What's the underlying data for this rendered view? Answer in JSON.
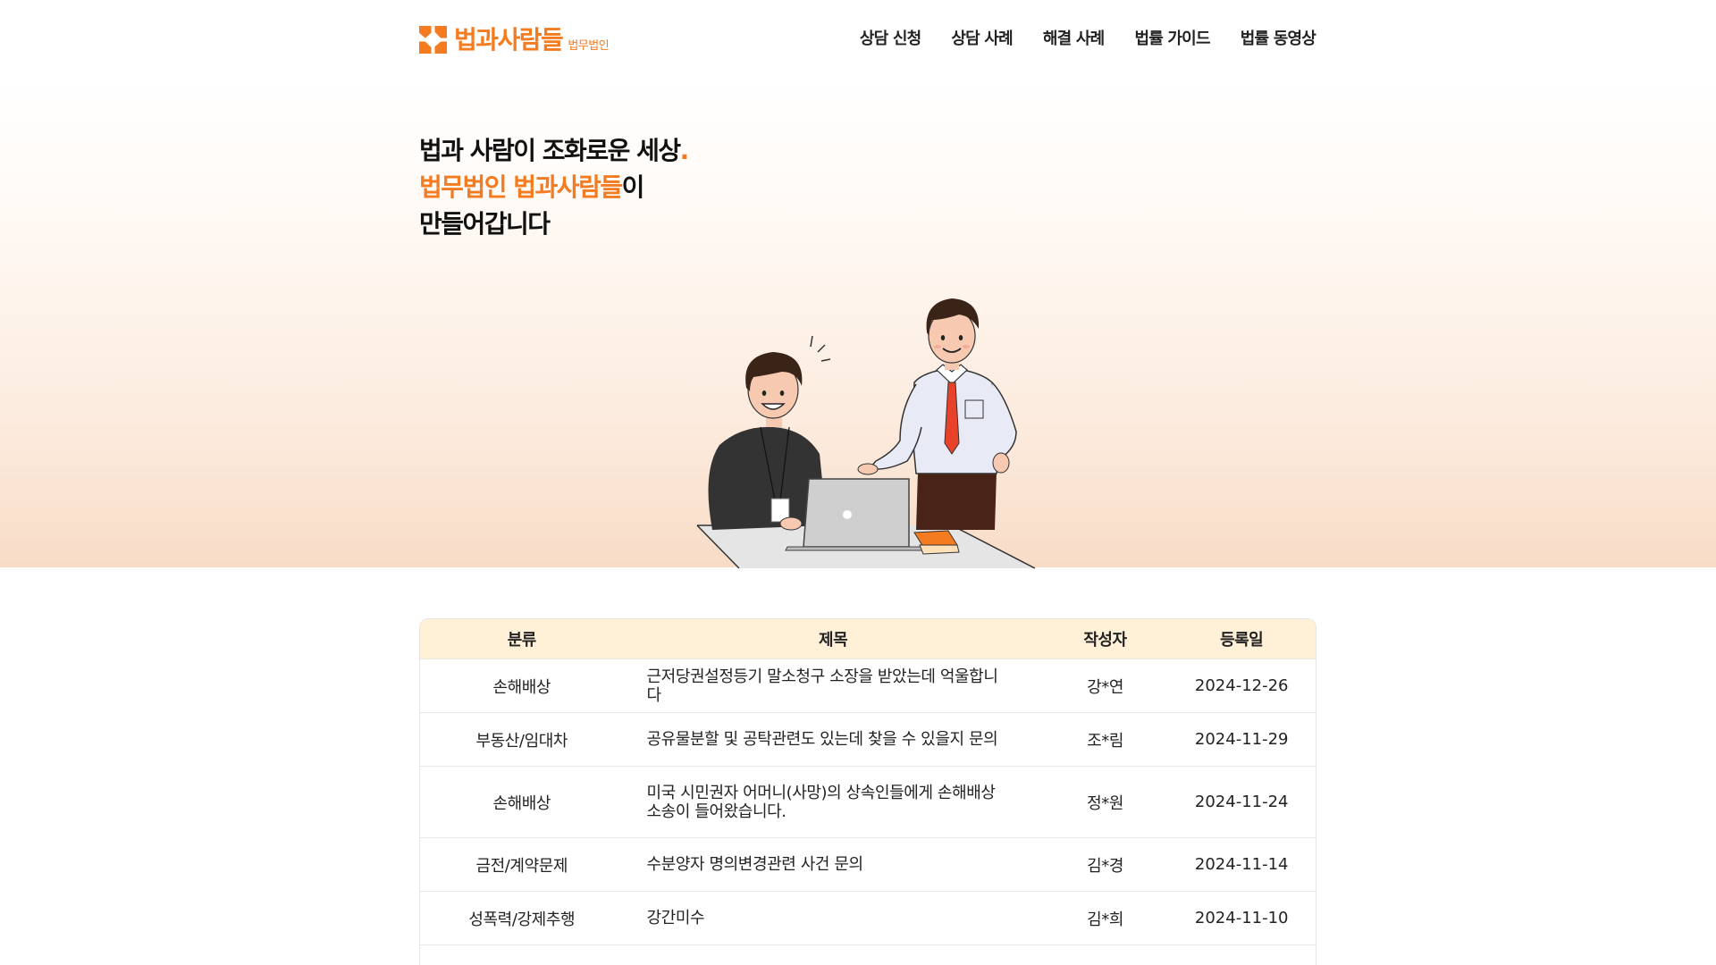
{
  "brand": {
    "name": "법과사람들",
    "sub": "법무법인",
    "color": "#f47b20"
  },
  "nav": [
    {
      "label": "상담 신청"
    },
    {
      "label": "상담 사례"
    },
    {
      "label": "해결 사례"
    },
    {
      "label": "법률 가이드"
    },
    {
      "label": "법률 동영상"
    }
  ],
  "hero": {
    "line1": "법과 사람이 조화로운 세상",
    "line1_dot": ".",
    "line2_highlight": "법무법인 법과사람들",
    "line2_rest": "이",
    "line3": "만들어갑니다"
  },
  "table": {
    "headers": {
      "category": "분류",
      "title": "제목",
      "writer": "작성자",
      "date": "등록일"
    },
    "rows": [
      {
        "category": "손해배상",
        "title": "근저당권설정등기 말소청구 소장을 받았는데 억울합니다",
        "writer": "강*연",
        "date": "2024-12-26"
      },
      {
        "category": "부동산/임대차",
        "title": "공유물분할 및 공탁관련도 있는데 찾을 수 있을지 문의",
        "writer": "조*림",
        "date": "2024-11-29"
      },
      {
        "category": "손해배상",
        "title": "미국 시민권자 어머니(사망)의 상속인들에게 손해배상 소송이 들어왔습니다.",
        "writer": "정*원",
        "date": "2024-11-24"
      },
      {
        "category": "금전/계약문제",
        "title": "수분양자 명의변경관련 사건 문의",
        "writer": "김*경",
        "date": "2024-11-14"
      },
      {
        "category": "성폭력/강제추행",
        "title": "강간미수",
        "writer": "김*희",
        "date": "2024-11-10"
      }
    ]
  }
}
